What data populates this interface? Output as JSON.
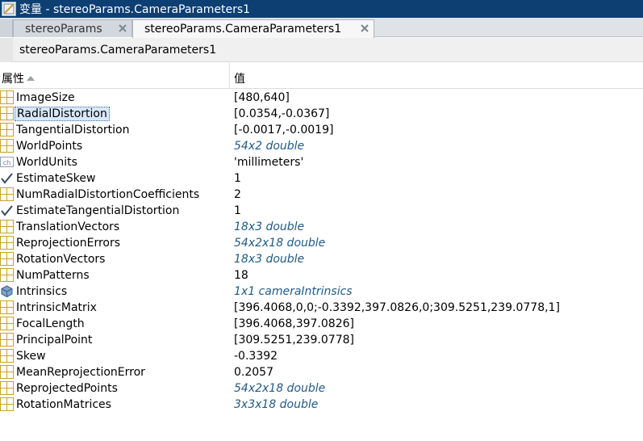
{
  "window": {
    "title": "变量 - stereoParams.CameraParameters1",
    "icon": "variable-editor-icon"
  },
  "tabs": [
    {
      "label": "stereoParams",
      "active": false
    },
    {
      "label": "stereoParams.CameraParameters1",
      "active": true
    }
  ],
  "path": "stereoParams.CameraParameters1",
  "columns": {
    "property": "属性",
    "value": "值"
  },
  "colors": {
    "titlebar": "#0d3f73",
    "link": "#1f5a85",
    "grid_icon": "#c9a227"
  },
  "rows": [
    {
      "name": "ImageSize",
      "value": "[480,640]",
      "icon": "grid-icon",
      "link": false,
      "selected": false
    },
    {
      "name": "RadialDistortion",
      "value": "[0.0354,-0.0367]",
      "icon": "grid-icon",
      "link": false,
      "selected": true
    },
    {
      "name": "TangentialDistortion",
      "value": "[-0.0017,-0.0019]",
      "icon": "grid-icon",
      "link": false,
      "selected": false
    },
    {
      "name": "WorldPoints",
      "value": "54x2 double",
      "icon": "grid-icon",
      "link": true,
      "selected": false
    },
    {
      "name": "WorldUnits",
      "value": "'millimeters'",
      "icon": "char-icon",
      "link": false,
      "selected": false
    },
    {
      "name": "EstimateSkew",
      "value": "1",
      "icon": "check-icon",
      "link": false,
      "selected": false
    },
    {
      "name": "NumRadialDistortionCoefficients",
      "value": "2",
      "icon": "grid-icon",
      "link": false,
      "selected": false
    },
    {
      "name": "EstimateTangentialDistortion",
      "value": "1",
      "icon": "check-icon",
      "link": false,
      "selected": false
    },
    {
      "name": "TranslationVectors",
      "value": "18x3 double",
      "icon": "grid-icon",
      "link": true,
      "selected": false
    },
    {
      "name": "ReprojectionErrors",
      "value": "54x2x18 double",
      "icon": "grid-icon",
      "link": true,
      "selected": false
    },
    {
      "name": "RotationVectors",
      "value": "18x3 double",
      "icon": "grid-icon",
      "link": true,
      "selected": false
    },
    {
      "name": "NumPatterns",
      "value": "18",
      "icon": "grid-icon",
      "link": false,
      "selected": false
    },
    {
      "name": "Intrinsics",
      "value": "1x1 cameraIntrinsics",
      "icon": "object-icon",
      "link": true,
      "selected": false
    },
    {
      "name": "IntrinsicMatrix",
      "value": "[396.4068,0,0;-0.3392,397.0826,0;309.5251,239.0778,1]",
      "icon": "grid-icon",
      "link": false,
      "selected": false
    },
    {
      "name": "FocalLength",
      "value": "[396.4068,397.0826]",
      "icon": "grid-icon",
      "link": false,
      "selected": false
    },
    {
      "name": "PrincipalPoint",
      "value": "[309.5251,239.0778]",
      "icon": "grid-icon",
      "link": false,
      "selected": false
    },
    {
      "name": "Skew",
      "value": "-0.3392",
      "icon": "grid-icon",
      "link": false,
      "selected": false
    },
    {
      "name": "MeanReprojectionError",
      "value": "0.2057",
      "icon": "grid-icon",
      "link": false,
      "selected": false
    },
    {
      "name": "ReprojectedPoints",
      "value": "54x2x18 double",
      "icon": "grid-icon",
      "link": true,
      "selected": false
    },
    {
      "name": "RotationMatrices",
      "value": "3x3x18 double",
      "icon": "grid-icon",
      "link": true,
      "selected": false
    }
  ]
}
